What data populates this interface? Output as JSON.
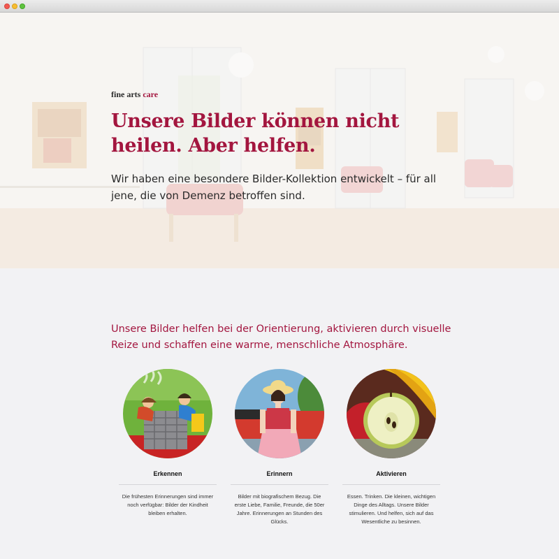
{
  "brand": {
    "name_part1": "fine arts",
    "name_part2": "care"
  },
  "hero": {
    "title": "Unsere Bilder können nicht heilen. Aber helfen.",
    "subtitle": "Wir haben eine besondere Bilder-Kollektion entwickelt – für all jene, die von Demenz betroffen sind."
  },
  "intro": "Unsere Bilder helfen bei der Orientierung, aktivieren durch visuelle Reize und schaffen eine warme, menschliche Atmosphäre.",
  "features": [
    {
      "title": "Erkennen",
      "text": "Die frühesten Erinnerungen sind immer noch verfügbar: Bilder der Kindheit bleiben erhalten."
    },
    {
      "title": "Erinnern",
      "text": "Bilder mit biografischem Bezug. Die erste Liebe, Familie, Freunde, die 50er Jahre. Erinnerungen an Stunden des Glücks."
    },
    {
      "title": "Aktivieren",
      "text": "Essen. Trinken. Die kleinen, wichtigen Dinge des Alltags. Unsere Bilder stimulieren. Und helfen, sich auf das Wesentliche zu besinnen."
    }
  ],
  "colors": {
    "accent": "#a3163f",
    "background": "#f2f2f4"
  }
}
